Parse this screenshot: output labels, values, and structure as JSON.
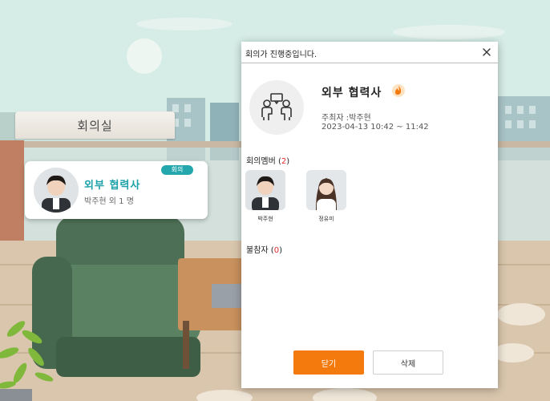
{
  "room": {
    "label": "회의실"
  },
  "card": {
    "title": "외부 협력사",
    "host_line": "박주현 외 1 명",
    "badge": "회의"
  },
  "dialog": {
    "title": "회의가 진행중입니다.",
    "meeting_title": "외부 협력사",
    "host": "주최자 :박주현",
    "time": "2023-04-13 10:42 ~ 11:42",
    "members_label": "회의멤버",
    "members_count": "2",
    "members": [
      {
        "name": "박주현"
      },
      {
        "name": "정유미"
      }
    ],
    "absent_label": "불참자",
    "absent_count": "0",
    "close_button": "닫기",
    "delete_button": "삭제"
  },
  "colors": {
    "accent": "#f47a0e",
    "teal": "#1ca1a8",
    "count_red": "#e52b2b"
  }
}
